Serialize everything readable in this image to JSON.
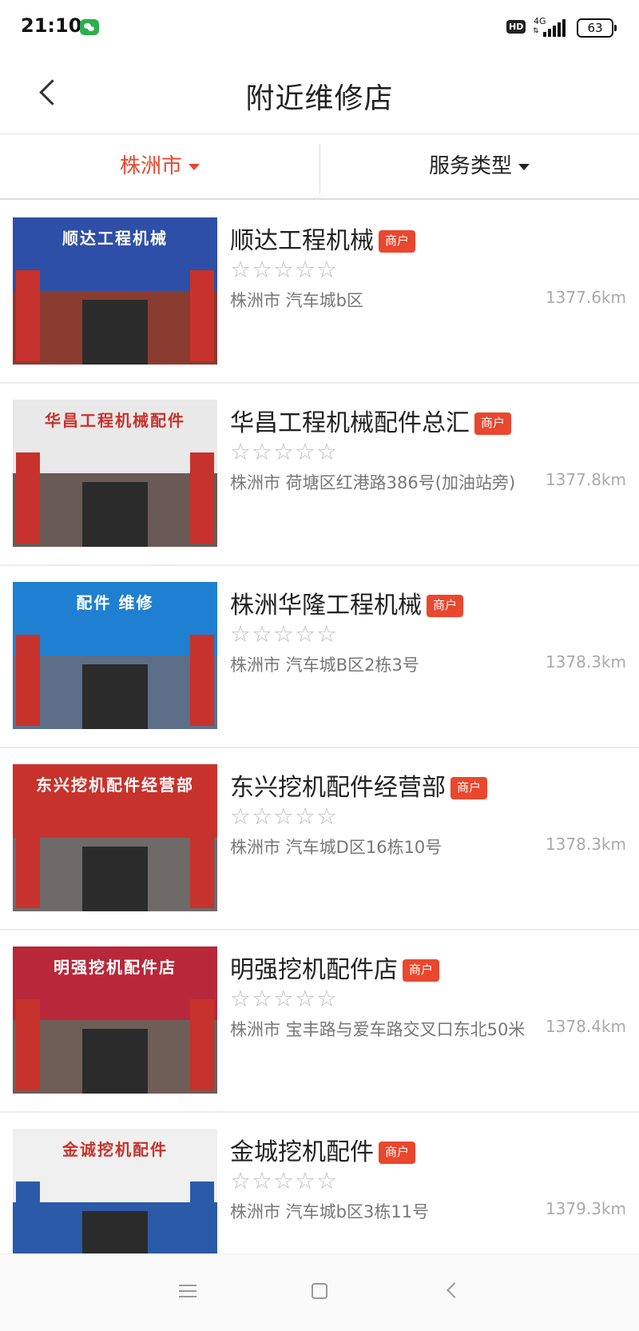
{
  "status_bar": {
    "time": "21:10",
    "hd": "HD",
    "network": "4G",
    "battery": "63"
  },
  "header": {
    "title": "附近维修店"
  },
  "filters": {
    "city": "株洲市",
    "service_type": "服务类型"
  },
  "colors": {
    "accent": "#e9472e",
    "text_primary": "#222222",
    "text_secondary": "#777777",
    "star_empty": "#bdbdbd"
  },
  "shops": [
    {
      "name": "顺达工程机械",
      "badge": "商户",
      "rating": "☆☆☆☆☆",
      "address": "株洲市 汽车城b区",
      "distance": "1377.6km",
      "sign_color": "#2e4fa8",
      "wall_color": "#8a3b2f",
      "sign_text": "顺达工程机械"
    },
    {
      "name": "华昌工程机械配件总汇",
      "badge": "商户",
      "rating": "☆☆☆☆☆",
      "address": "株洲市 荷塘区红港路386号(加油站旁)",
      "distance": "1377.8km",
      "sign_color": "#e9e9e9",
      "wall_color": "#6a5a55",
      "sign_text": "华昌工程机械配件"
    },
    {
      "name": "株洲华隆工程机械",
      "badge": "商户",
      "rating": "☆☆☆☆☆",
      "address": "株洲市 汽车城B区2栋3号",
      "distance": "1378.3km",
      "sign_color": "#1f7fd0",
      "wall_color": "#5d6f88",
      "sign_text": "配件 维修"
    },
    {
      "name": "东兴挖机配件经营部",
      "badge": "商户",
      "rating": "☆☆☆☆☆",
      "address": "株洲市 汽车城D区16栋10号",
      "distance": "1378.3km",
      "sign_color": "#c8322c",
      "wall_color": "#6e6a68",
      "sign_text": "东兴挖机配件经营部"
    },
    {
      "name": "明强挖机配件店",
      "badge": "商户",
      "rating": "☆☆☆☆☆",
      "address": "株洲市 宝丰路与爱车路交叉口东北50米",
      "distance": "1378.4km",
      "sign_color": "#b8283a",
      "wall_color": "#6f5e58",
      "sign_text": "明强挖机配件店"
    },
    {
      "name": "金城挖机配件",
      "badge": "商户",
      "rating": "☆☆☆☆☆",
      "address": "株洲市 汽车城b区3栋11号",
      "distance": "1379.3km",
      "sign_color": "#f0f0f0",
      "wall_color": "#2a5aa8",
      "sign_text": "金诚挖机配件"
    }
  ]
}
